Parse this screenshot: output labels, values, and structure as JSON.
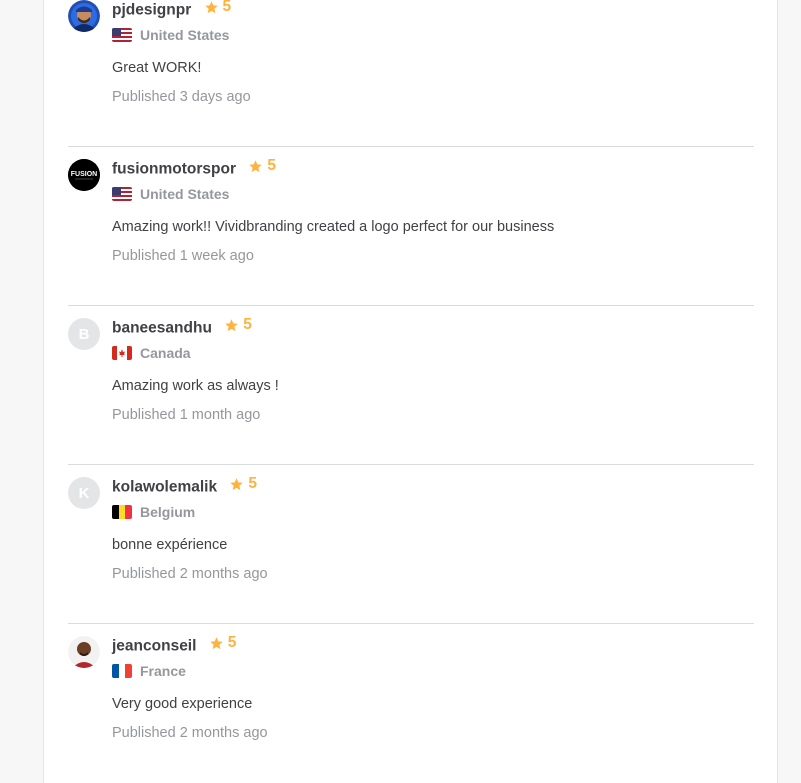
{
  "colors": {
    "star": "#ffb33e",
    "muted": "#95979d",
    "text": "#404145",
    "divider": "#dadbdd"
  },
  "reviews": [
    {
      "username": "pjdesignpr",
      "rating": "5",
      "country": "United States",
      "flag": "us-flag-icon",
      "text": "Great WORK!",
      "published": "Published 3 days ago",
      "avatar": "photo"
    },
    {
      "username": "fusionmotorspor",
      "rating": "5",
      "country": "United States",
      "flag": "us-flag-icon",
      "text": "Amazing work!! Vividbranding created a logo perfect for our business",
      "published": "Published 1 week ago",
      "avatar": "logo",
      "avatar_logo_text": "FUSION"
    },
    {
      "username": "baneesandhu",
      "rating": "5",
      "country": "Canada",
      "flag": "canada-flag-icon",
      "text": "Amazing work as always !",
      "published": "Published 1 month ago",
      "avatar": "letter",
      "avatar_letter": "B"
    },
    {
      "username": "kolawolemalik",
      "rating": "5",
      "country": "Belgium",
      "flag": "belgium-flag-icon",
      "text": "bonne expérience",
      "published": "Published 2 months ago",
      "avatar": "letter",
      "avatar_letter": "K"
    },
    {
      "username": "jeanconseil",
      "rating": "5",
      "country": "France",
      "flag": "france-flag-icon",
      "text": "Very good experience",
      "published": "Published 2 months ago",
      "avatar": "photo"
    }
  ]
}
